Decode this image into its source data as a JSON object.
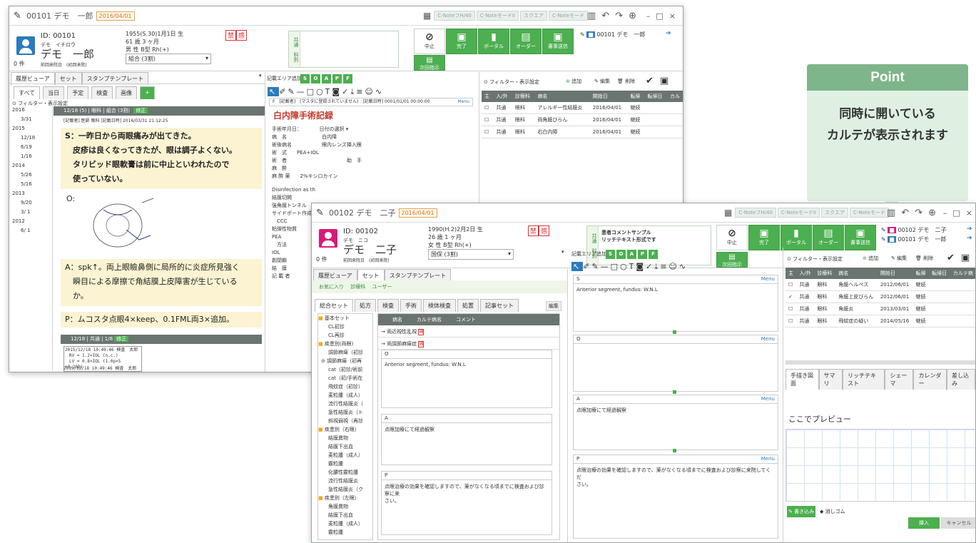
{
  "win1": {
    "title": "00101 デモ　一郎",
    "date": "2016/04/01",
    "mini_tabs": [
      "C-NoteフH/40",
      "C-NoteモードII",
      "スクエア",
      "C-Noteモード"
    ],
    "patient": {
      "id": "ID: 00101",
      "kana": "デモ　イチロウ",
      "name": "デモ　一郎",
      "count": "0 件",
      "lastvisit": "前回来院日　(初回来院)",
      "birth": "1955(S.30)1月1日 生",
      "age": "61 歳 3 ヶ月",
      "sex": "男 性 B型 Rh(+)",
      "insurance": "組合 (3割)",
      "tags": [
        "禁",
        "感"
      ]
    },
    "comment_labels": {
      "top": "共通",
      "bottom": "科別"
    },
    "buttons": [
      {
        "icon": "⊘",
        "label": "中止"
      },
      {
        "icon": "▣",
        "label": "完了"
      },
      {
        "icon": "▮",
        "label": "ポータル"
      },
      {
        "icon": "▤",
        "label": "オーダー"
      },
      {
        "icon": "▣",
        "label": "書事送信"
      },
      {
        "icon": "▤",
        "label": "次回指示"
      }
    ],
    "open_list": [
      "00101 デモ　一郎"
    ],
    "left_tabs": [
      "履歴ビューア",
      "セット",
      "スタンプテンプレート"
    ],
    "filter_tabs": [
      "すべて",
      "当日",
      "予定",
      "検査",
      "画像"
    ],
    "filter_label": "フィルター・表示設定",
    "tree": [
      "2016",
      "3/31",
      "2015",
      "12/18",
      "6/19",
      "1/16",
      "2014",
      "5/26",
      "5/16",
      "2013",
      "9/20",
      "3/ 1",
      "2012",
      "6/ 1"
    ],
    "record_hd": "12/18 (5) | 眼科 | 組合 (3割)",
    "record_hd_edit": "修正",
    "record_sub": "[記載者] 医師 眼科 [記載日時] 2016/03/31 21:12:25",
    "s_lines": [
      "S：一昨日から両眼痛みが出てきた。",
      "　皮疹は良くなってきたが、眼は調子よくない。",
      "　タリビッド眼軟膏は前に中止といわれたので",
      "　使っていない。"
    ],
    "o_label": "O:",
    "a_lines": [
      "A：spk↑。両上眼瞼鼻側に局所的に炎症所見強く",
      "　瞬目による摩擦で角結膜上皮障害が生じている",
      "　か。"
    ],
    "p_line": "P：ムコスタ点眼4×keep、0.1FML両3×追加。",
    "record2_hd": "12/18 | 共通 | 1/8",
    "record2_edit": "修正",
    "record2_lines": [
      "2015/12/18 10:49:46 検査　太郎",
      "　RV = 1.2×IOL (n.c.)",
      "　LV = 0.8×IOL (1.0p×S +0.25D)"
    ],
    "record3_line": "2015/12/18 10:49:46 検査　太郎",
    "area_label": "記載エリア追加",
    "soap": [
      "S",
      "O",
      "A",
      "P",
      "F"
    ],
    "surgery_top": "F　[記載者]　(マスタに登録されていません)　[記載日時] 0001/01/01 00:00:00",
    "surgery_menu": "Menu",
    "surgery_title": "白内障手術記録",
    "surgery_rows": [
      "手術年月日：　　　　日付の選択 ▾",
      "病　名　　　　　　　白内障",
      "術後病名　　　　　　眼内レンズ挿入眼",
      "術　式　　PEA+IOL",
      "術　者　　　　　　　　　　　　助　手",
      "麻　酔",
      "麻 酔 薬　　2%キシロカイン"
    ],
    "surgery_more": [
      "Disinfection as th",
      "結膜切開",
      "強角膜トンネル",
      "サイドポート作成",
      "　CCC",
      "粘弾性物質",
      "PEA",
      "　方法",
      "IOL",
      "創閉鎖",
      "結　膜",
      "",
      "",
      "記 載 者"
    ],
    "right_filter": "フィルター・表示設定",
    "right_btns": [
      "追加",
      "編集",
      "削除"
    ],
    "dx_headers": [
      "主",
      "入/外",
      "診療科",
      "病名",
      "開始日",
      "転帰",
      "転帰日",
      "カル"
    ],
    "dx_rows": [
      [
        "",
        "共通",
        "眼科",
        "アレルギー性結膜炎",
        "2016/04/01",
        "継続"
      ],
      [
        "",
        "共通",
        "眼科",
        "両角膜びらん",
        "2016/04/01",
        "継続"
      ],
      [
        "",
        "共通",
        "眼科",
        "右白内障",
        "2016/04/01",
        "継続"
      ]
    ]
  },
  "win2": {
    "title": "00102 デモ　二子",
    "date": "2016/04/01",
    "patient": {
      "id": "ID: 00102",
      "kana": "デモ　ニコ",
      "name": "デモ　二子",
      "count": "0 件",
      "lastvisit": "前回来院日　(初回来院)",
      "birth": "1990(H.2)2月2日 生",
      "age": "26 歳 1 ヶ月",
      "sex": "女 性 B型 Rh(+)",
      "insurance": "国保 (3割)",
      "tags": [
        "禁",
        "感"
      ]
    },
    "comment": [
      "患者コメントサンプル",
      "リッチテキスト形式です"
    ],
    "open_list": [
      "00102 デモ　二子",
      "00101 デモ　一郎"
    ],
    "left_tabs": [
      "履歴ビューア",
      "セット",
      "スタンプテンプレート"
    ],
    "fav_tabs": [
      "お気に入り",
      "診療科",
      "ユーザー"
    ],
    "set_tabs": [
      "総合セット",
      "処方",
      "検査",
      "手術",
      "検体検査",
      "処置",
      "記事セット"
    ],
    "edit": "編集",
    "set_tree": [
      "基本セット",
      "CL初診",
      "CL再診",
      "疾患別(両眼)",
      "調節麻痺（初診",
      "調節麻痺（初再",
      "cat（初診/術前",
      "cat（初/手術在",
      "飛蚊症（初診）",
      "麦粒腫（成人）",
      "流行性結膜炎（",
      "急性結膜炎（ト",
      "斜視弱視（再診",
      "疾患別（右眼）",
      "結膜異物",
      "結膜下出血",
      "麦粒腫（成人）",
      "霰粒腫",
      "化膿性霰粒腫",
      "流行性結膜炎",
      "急性結膜炎（ク",
      "疾患別（左眼）",
      "角膜異物",
      "結膜下出血",
      "麦粒腫（成人）",
      "霰粒腫"
    ],
    "set_headers": [
      "病名",
      "カルテ病名",
      "コメント"
    ],
    "set_rows": [
      "両近視性乱視",
      "両調節麻痺症"
    ],
    "o_text": "Anterior segment, fundus: W.N.L",
    "a_text": "点眼加療にて経過観察",
    "p_text": "点眼治療の効果を確認しますので、薬がなくなる頃までに検査および診察に来",
    "p_text2": "さい。",
    "area_label": "記載エリア追加",
    "soap": [
      "S",
      "O",
      "A",
      "P",
      "F"
    ],
    "rs": "Anterior segment, fundus: W.N.L",
    "ra": "点眼加療にて経過観察",
    "rp1": "点眼治療の効果を確認しますので、薬がなくなる頃までに検査および診察に来院してくだ",
    "rp2": "さい。",
    "menu": "Menu",
    "right_filter": "フィルター・表示設定",
    "right_btns": [
      "追加",
      "編集",
      "削除"
    ],
    "dx_headers": [
      "主",
      "入/外",
      "診療科",
      "病名",
      "開始日",
      "転帰",
      "転帰日",
      "カルテ病"
    ],
    "dx_rows": [
      [
        "",
        "共通",
        "眼科",
        "角膜ヘルペス",
        "2012/06/01",
        "継続"
      ],
      [
        "✓",
        "共通",
        "眼科",
        "角膜上皮びらん",
        "2012/06/01",
        "継続"
      ],
      [
        "",
        "共通",
        "眼科",
        "角膜炎",
        "2013/03/01",
        "継続"
      ],
      [
        "",
        "共通",
        "眼科",
        "飛蚊症の疑い",
        "2014/05/16",
        "継続"
      ]
    ],
    "bottom_tabs": [
      "手描き図面",
      "サマリ",
      "リッチテキスト",
      "シェーマ",
      "カレンダー",
      "差し込み"
    ],
    "preview": "ここでプレビュー",
    "draw_btns": [
      "書き込み",
      "消しゴム"
    ],
    "insert": "挿入",
    "cancel": "キャンセル"
  },
  "callout": {
    "head": "Point",
    "body1": "同時に開いている",
    "body2": "カルテが表示されます"
  }
}
